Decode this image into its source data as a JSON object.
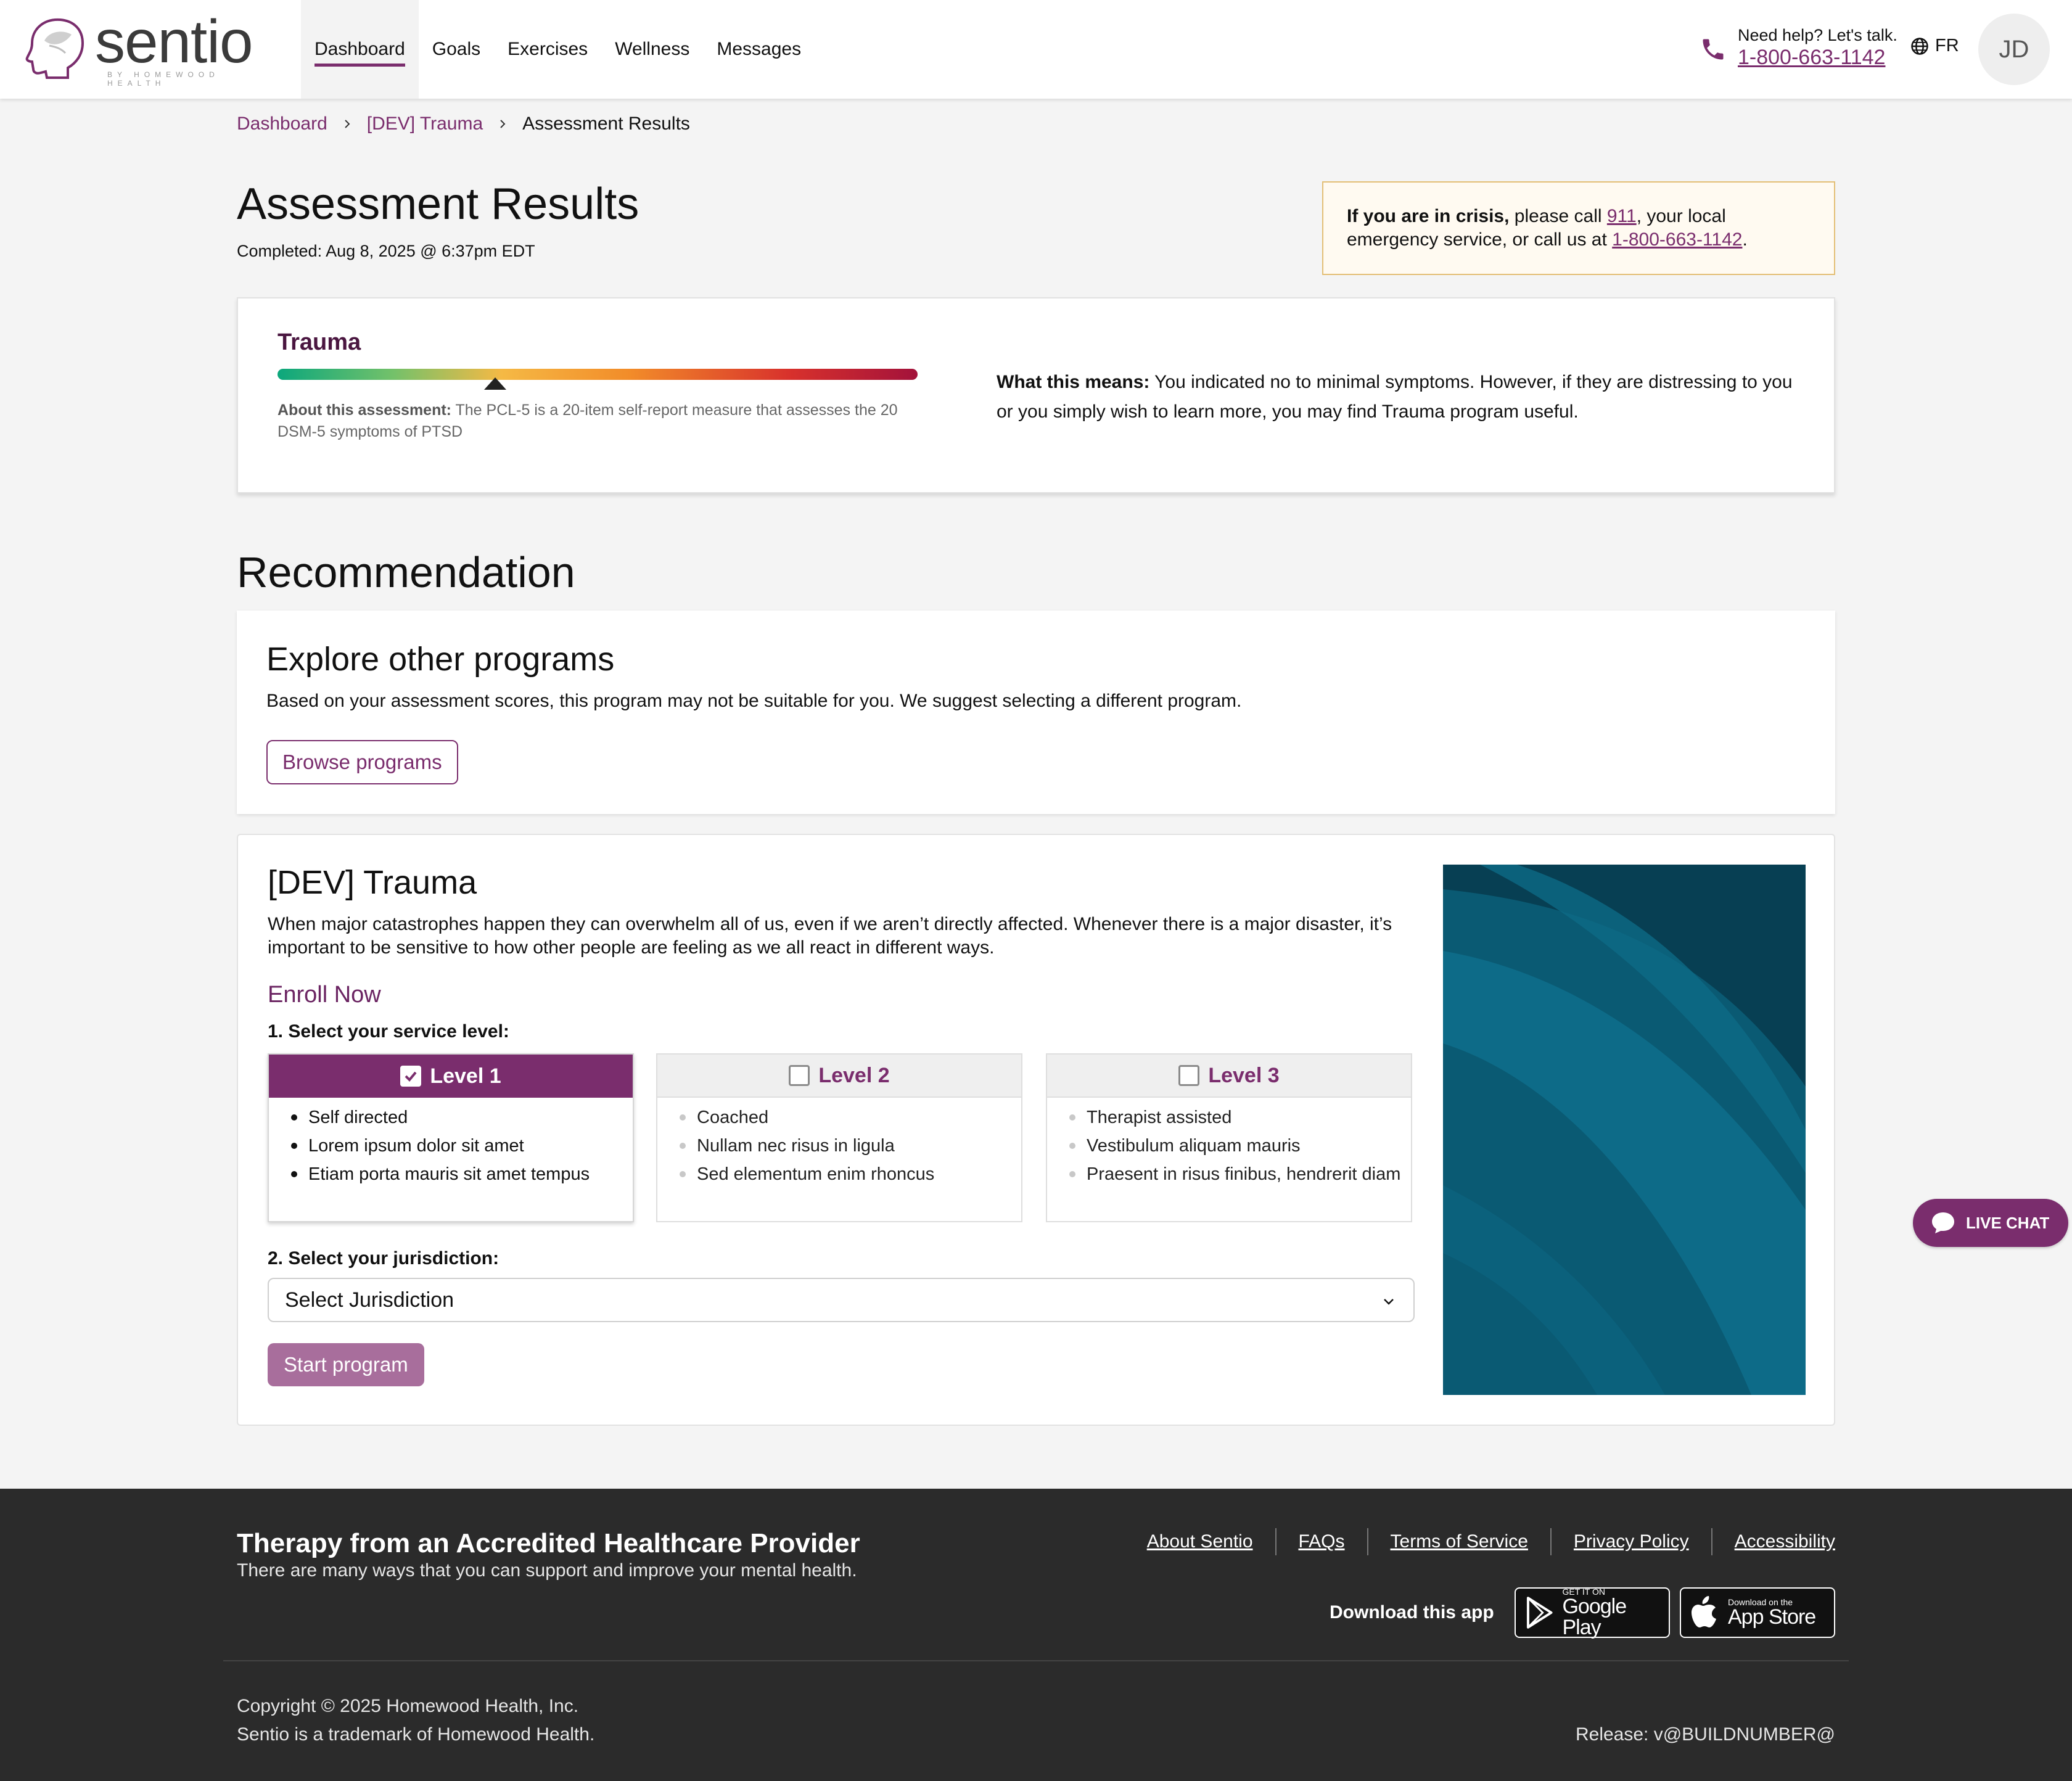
{
  "header": {
    "logo_text": "sentio",
    "logo_sub": "BY HOMEWOOD HEALTH",
    "nav": [
      {
        "label": "Dashboard",
        "active": true
      },
      {
        "label": "Goals"
      },
      {
        "label": "Exercises"
      },
      {
        "label": "Wellness"
      },
      {
        "label": "Messages"
      }
    ],
    "help_label": "Need help? Let's talk.",
    "help_phone": "1-800-663-1142",
    "lang": "FR",
    "avatar_initials": "JD",
    "icons": {
      "phone": "phone-icon",
      "globe": "globe-icon"
    }
  },
  "breadcrumb": {
    "items": [
      "Dashboard",
      "[DEV] Trauma"
    ],
    "current": "Assessment Results"
  },
  "page": {
    "title": "Assessment Results",
    "completed": "Completed: Aug 8, 2025 @ 6:37pm EDT"
  },
  "crisis": {
    "bold": "If you are in crisis,",
    "text1": " please call ",
    "num911": "911",
    "text2": ", your local emergency service, or call us at ",
    "phone": "1-800-663-1142",
    "text3": "."
  },
  "result": {
    "title": "Trauma",
    "score_position": 0.34,
    "about_label": "About this assessment:",
    "about_text": " The PCL-5 is a 20-item self-report measure that assesses the 20 DSM-5 symptoms of PTSD",
    "means_label": "What this means:",
    "means_text": " You indicated no to minimal symptoms. However, if they are distressing to you or you simply wish to learn more, you may find Trauma program useful."
  },
  "recommendation": {
    "heading": "Recommendation",
    "explore_title": "Explore other programs",
    "explore_text": "Based on your assessment scores, this program may not be suitable for you. We suggest selecting a different program.",
    "browse_label": "Browse programs"
  },
  "program": {
    "title": "[DEV] Trauma",
    "description": "When major catastrophes happen they can overwhelm all of us, even if we aren’t directly affected. Whenever there is a major disaster, it’s important to be sensitive to how other people are feeling as we all react in different ways.",
    "enroll_label": "Enroll Now",
    "step1_label": "1. Select your service level:",
    "levels": [
      {
        "label": "Level 1",
        "selected": true,
        "items": [
          "Self directed",
          "Lorem ipsum dolor sit amet",
          "Etiam porta mauris sit amet tempus"
        ]
      },
      {
        "label": "Level 2",
        "selected": false,
        "items": [
          "Coached",
          "Nullam nec risus in ligula",
          "Sed elementum enim rhoncus"
        ]
      },
      {
        "label": "Level 3",
        "selected": false,
        "items": [
          "Therapist assisted",
          "Vestibulum aliquam mauris",
          "Praesent in risus finibus, hendrerit diam"
        ]
      }
    ],
    "step2_label": "2. Select your jurisdiction:",
    "jurisdiction_value": "Select Jurisdiction",
    "start_label": "Start program",
    "image_colors": {
      "base": "#0a5a73",
      "dark": "#063e52",
      "light": "#0f7a99"
    }
  },
  "live_chat": {
    "label": "LIVE CHAT"
  },
  "footer": {
    "title": "Therapy from an Accredited Healthcare Provider",
    "subtitle": "There are many ways that you can support and improve your mental health.",
    "links": [
      "About Sentio",
      "FAQs",
      "Terms of Service",
      "Privacy Policy",
      "Accessibility"
    ],
    "download_label": "Download this app",
    "google_small": "GET IT ON",
    "google_big": "Google Play",
    "apple_small": "Download on the",
    "apple_big": "App Store",
    "copyright": "Copyright © 2025 Homewood Health, Inc.",
    "trademark": "Sentio is a trademark of Homewood Health.",
    "release": "Release: v@BUILDNUMBER@"
  },
  "colors": {
    "brand": "#7a2d6d",
    "brand_dark": "#4a1640",
    "footer_bg": "#2b2b2b",
    "crisis_bg": "#fffaf1",
    "crisis_border": "#e3bf76"
  }
}
